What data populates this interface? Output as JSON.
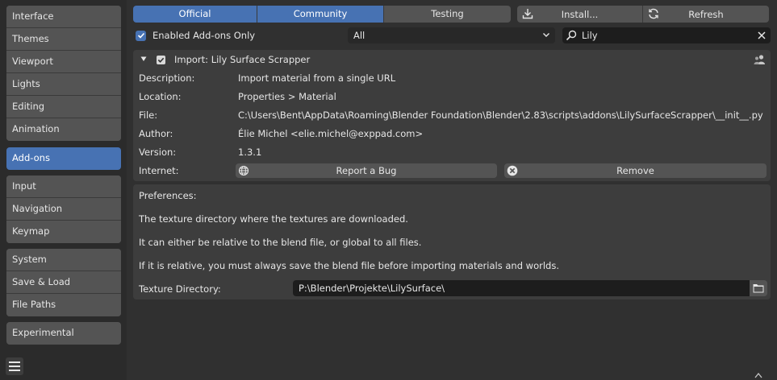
{
  "sidebar": {
    "groups": [
      [
        "Interface",
        "Themes",
        "Viewport",
        "Lights",
        "Editing",
        "Animation"
      ],
      [
        "Add-ons"
      ],
      [
        "Input",
        "Navigation",
        "Keymap"
      ],
      [
        "System",
        "Save & Load",
        "File Paths"
      ],
      [
        "Experimental"
      ]
    ],
    "active": "Add-ons"
  },
  "tabs": [
    {
      "label": "Official",
      "active": true
    },
    {
      "label": "Community",
      "active": true
    },
    {
      "label": "Testing",
      "active": false
    }
  ],
  "actions": {
    "install_label": "Install...",
    "refresh_label": "Refresh"
  },
  "filter": {
    "enabled_only_label": "Enabled Add-ons Only",
    "enabled_only_checked": true,
    "category_value": "All",
    "search_value": "Lily"
  },
  "addon": {
    "title": "Import: Lily Surface Scrapper",
    "enabled": true,
    "info": [
      {
        "label": "Description:",
        "value": "Import material from a single URL"
      },
      {
        "label": "Location:",
        "value": "Properties > Material"
      },
      {
        "label": "File:",
        "value": "C:\\Users\\Bent\\AppData\\Roaming\\Blender Foundation\\Blender\\2.83\\scripts\\addons\\LilySurfaceScrapper\\__init__.py"
      },
      {
        "label": "Author:",
        "value": "Élie Michel <elie.michel@exppad.com>"
      },
      {
        "label": "Version:",
        "value": "1.3.1"
      }
    ],
    "internet_label": "Internet:",
    "report_bug_label": "Report a Bug",
    "remove_label": "Remove"
  },
  "preferences": {
    "heading": "Preferences:",
    "lines": [
      "The texture directory where the textures are downloaded.",
      "It can either be relative to the blend file, or global to all files.",
      "If it is relative, you must always save the blend file before importing materials and worlds."
    ],
    "texture_dir_label": "Texture Directory:",
    "texture_dir_value": "P:\\Blender\\Projekte\\LilySurface\\"
  },
  "colors": {
    "accent": "#4772b3",
    "button": "#545454",
    "panel": "#3d3d3d",
    "background": "#303030",
    "field": "#1d1d1d"
  },
  "icons": [
    "import-icon",
    "refresh-icon",
    "chevron-down-icon",
    "search-icon",
    "close-icon",
    "expand-arrow-icon",
    "user-icon",
    "globe-icon",
    "remove-icon",
    "folder-icon",
    "menu-icon",
    "scroll-up-icon"
  ]
}
